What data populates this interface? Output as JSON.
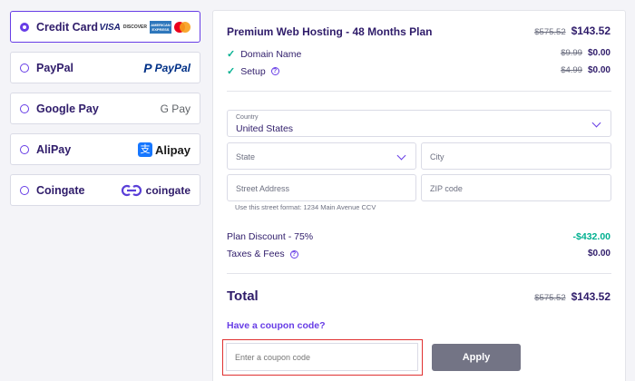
{
  "payment_methods": [
    {
      "label": "Credit Card",
      "selected": true
    },
    {
      "label": "PayPal",
      "logo_text_1": "P",
      "logo_text_2": "PayPal"
    },
    {
      "label": "Google Pay",
      "logo_text": "G Pay"
    },
    {
      "label": "AliPay",
      "logo_text": "Alipay",
      "logo_glyph": "支"
    },
    {
      "label": "Coingate",
      "logo_text": "coingate"
    }
  ],
  "card_logos": {
    "visa": "VISA",
    "discover": "DISCOVER",
    "amex": "AMERICAN EXPRESS"
  },
  "plan": {
    "title": "Premium Web Hosting - 48 Months Plan",
    "old_price": "$575.52",
    "price": "$143.52",
    "features": [
      {
        "label": "Domain Name",
        "old_price": "$9.99",
        "price": "$0.00",
        "help": false
      },
      {
        "label": "Setup",
        "old_price": "$4.99",
        "price": "$0.00",
        "help": true
      }
    ]
  },
  "address": {
    "country_label": "Country",
    "country_value": "United States",
    "state_placeholder": "State",
    "city_placeholder": "City",
    "street_placeholder": "Street Address",
    "zip_placeholder": "ZIP code",
    "street_hint": "Use this street format: 1234 Main Avenue CCV"
  },
  "summary": {
    "discount_label": "Plan Discount - 75%",
    "discount_value": "-$432.00",
    "taxes_label": "Taxes & Fees",
    "taxes_value": "$0.00",
    "total_label": "Total",
    "total_old": "$575.52",
    "total_value": "$143.52"
  },
  "coupon": {
    "link": "Have a coupon code?",
    "placeholder": "Enter a coupon code",
    "apply_label": "Apply"
  },
  "colors": {
    "accent": "#673de6",
    "success": "#00b090",
    "text": "#2f1c6a",
    "highlight": "#e03131"
  }
}
